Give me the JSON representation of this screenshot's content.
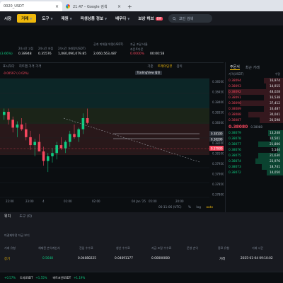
{
  "browser": {
    "tabs": [
      {
        "title": "0020_USDT"
      },
      {
        "title": "21.47 – Google 검색"
      }
    ],
    "new_tab": "+"
  },
  "nav": {
    "items": [
      "시장",
      "거래",
      "도구",
      "재원",
      "파생상품 정보",
      "배우다",
      "보상 허브",
      "더"
    ],
    "badge": "신규",
    "search_placeholder": "코인 검색"
  },
  "ticker": {
    "change_pct": "(3.66%)",
    "stats": [
      {
        "label": "24시간 고점",
        "value": "0.38948"
      },
      {
        "label": "24시간 저점",
        "value": "0.35576"
      },
      {
        "label": "24시간 거래량(USDT)",
        "value": "1,060,090,079.85"
      },
      {
        "label": "공개 미체결 약정(USDT)",
        "value": "2,060,563,487"
      },
      {
        "label": "자금 조달 비율",
        "value": "0.0000%"
      },
      {
        "label": "카운트다운",
        "value": "00:00:58"
      }
    ]
  },
  "chart": {
    "toolbar": [
      "표시하다",
      "히트맵 가격 가격",
      "기준",
      "트레이딩뷰",
      "깊이"
    ],
    "tradingview_label": "TradingView 활용",
    "ohlc_text": "-0.00597 (-0.02%)",
    "price_axis": [
      "0.38500",
      "0.38450",
      "0.38400",
      "0.38350",
      "0.38300",
      "0.38250",
      "0.38200",
      "0.38100",
      "0.37950",
      "0.37900",
      "0.37850",
      "0.37800"
    ],
    "time_axis": [
      "22:00",
      "23:00",
      "4",
      "01:00",
      "02:00",
      "04 Jan '25",
      "05:00",
      "20:00"
    ],
    "price_badges": [
      {
        "value": "0.37900",
        "kind": "current"
      },
      {
        "value": "0.38200",
        "kind": "upper"
      },
      {
        "value": "0.38100",
        "kind": "line"
      }
    ],
    "footer_time": "00:11:06 (UTC)",
    "footer_pct": "%",
    "footer_log": "log",
    "footer_auto": "auto",
    "chart_data": {
      "type": "candlestick",
      "candles": [
        {
          "o": 0.3832,
          "h": 0.3836,
          "l": 0.3829,
          "c": 0.3834
        },
        {
          "o": 0.3834,
          "h": 0.3836,
          "l": 0.3826,
          "c": 0.3829
        },
        {
          "o": 0.3829,
          "h": 0.3831,
          "l": 0.3821,
          "c": 0.3824
        },
        {
          "o": 0.3824,
          "h": 0.3828,
          "l": 0.3818,
          "c": 0.3826
        },
        {
          "o": 0.3826,
          "h": 0.383,
          "l": 0.3822,
          "c": 0.3823
        },
        {
          "o": 0.3823,
          "h": 0.3827,
          "l": 0.3816,
          "c": 0.3818
        },
        {
          "o": 0.3818,
          "h": 0.3822,
          "l": 0.381,
          "c": 0.3813
        },
        {
          "o": 0.3813,
          "h": 0.3817,
          "l": 0.3806,
          "c": 0.3815
        },
        {
          "o": 0.3815,
          "h": 0.382,
          "l": 0.3812,
          "c": 0.3809
        },
        {
          "o": 0.3809,
          "h": 0.3812,
          "l": 0.38,
          "c": 0.3803
        },
        {
          "o": 0.3803,
          "h": 0.3808,
          "l": 0.3796,
          "c": 0.3806
        },
        {
          "o": 0.3806,
          "h": 0.3811,
          "l": 0.3802,
          "c": 0.3808
        },
        {
          "o": 0.3808,
          "h": 0.3815,
          "l": 0.3804,
          "c": 0.3813
        },
        {
          "o": 0.3813,
          "h": 0.3818,
          "l": 0.381,
          "c": 0.3811
        },
        {
          "o": 0.3811,
          "h": 0.3816,
          "l": 0.3808,
          "c": 0.3815
        },
        {
          "o": 0.3815,
          "h": 0.3822,
          "l": 0.3812,
          "c": 0.382
        },
        {
          "o": 0.382,
          "h": 0.3826,
          "l": 0.3817,
          "c": 0.3818
        },
        {
          "o": 0.3818,
          "h": 0.3824,
          "l": 0.3815,
          "c": 0.3823
        },
        {
          "o": 0.3823,
          "h": 0.3833,
          "l": 0.382,
          "c": 0.383
        },
        {
          "o": 0.383,
          "h": 0.3836,
          "l": 0.3826,
          "c": 0.3827
        }
      ],
      "ylim": [
        0.378,
        0.3855
      ]
    }
  },
  "orderbook": {
    "tabs": [
      "주문서",
      "최근 거래"
    ],
    "headers": [
      "가격(USDT)",
      "수량"
    ],
    "asks": [
      {
        "price": "0.38094",
        "qty": "16,974"
      },
      {
        "price": "0.38093",
        "qty": "14,915"
      },
      {
        "price": "0.38092",
        "qty": "48,028"
      },
      {
        "price": "0.38091",
        "qty": "16,538"
      },
      {
        "price": "0.38090",
        "qty": "37,412"
      },
      {
        "price": "0.38089",
        "qty": "16,487"
      },
      {
        "price": "0.38088",
        "qty": "30,041"
      },
      {
        "price": "0.38087",
        "qty": "20,598"
      }
    ],
    "mid_price": "0.38080",
    "mid_sub": "0.38088",
    "bids": [
      {
        "price": "0.38079",
        "qty": "13,248"
      },
      {
        "price": "0.38078",
        "qty": "10,501"
      },
      {
        "price": "0.38077",
        "qty": "21,806"
      },
      {
        "price": "0.38076",
        "qty": "5,144"
      },
      {
        "price": "0.38075",
        "qty": "21,630"
      },
      {
        "price": "0.38074",
        "qty": "23,976"
      },
      {
        "price": "0.38073",
        "qty": "18,741"
      },
      {
        "price": "0.38072",
        "qty": "14,050"
      }
    ]
  },
  "bottom": {
    "tabs": [
      "위치",
      "도구 (0)"
    ],
    "subtabs": "미결제약정  자금 보기",
    "headers": [
      "거래 유형",
      "체제된 손익계산서",
      "진입 수수료",
      "청산 수수료",
      "자금 조달 수수료",
      "운영 손익",
      "종료 유형",
      "거래 시간"
    ],
    "row": {
      "type": "장기",
      "pnl": "0.5648",
      "entry_fee": "0.04080225",
      "exit_fee": "0.04091177",
      "funding_fee": "0.00000000",
      "op_pnl": "",
      "close_type": "거래",
      "time": "2025-01-04 09:10:02"
    }
  },
  "footer": {
    "items": [
      "+0.57%",
      "도지USDT",
      "+1.55%",
      "비트코인USDT",
      "+1.19%"
    ]
  }
}
